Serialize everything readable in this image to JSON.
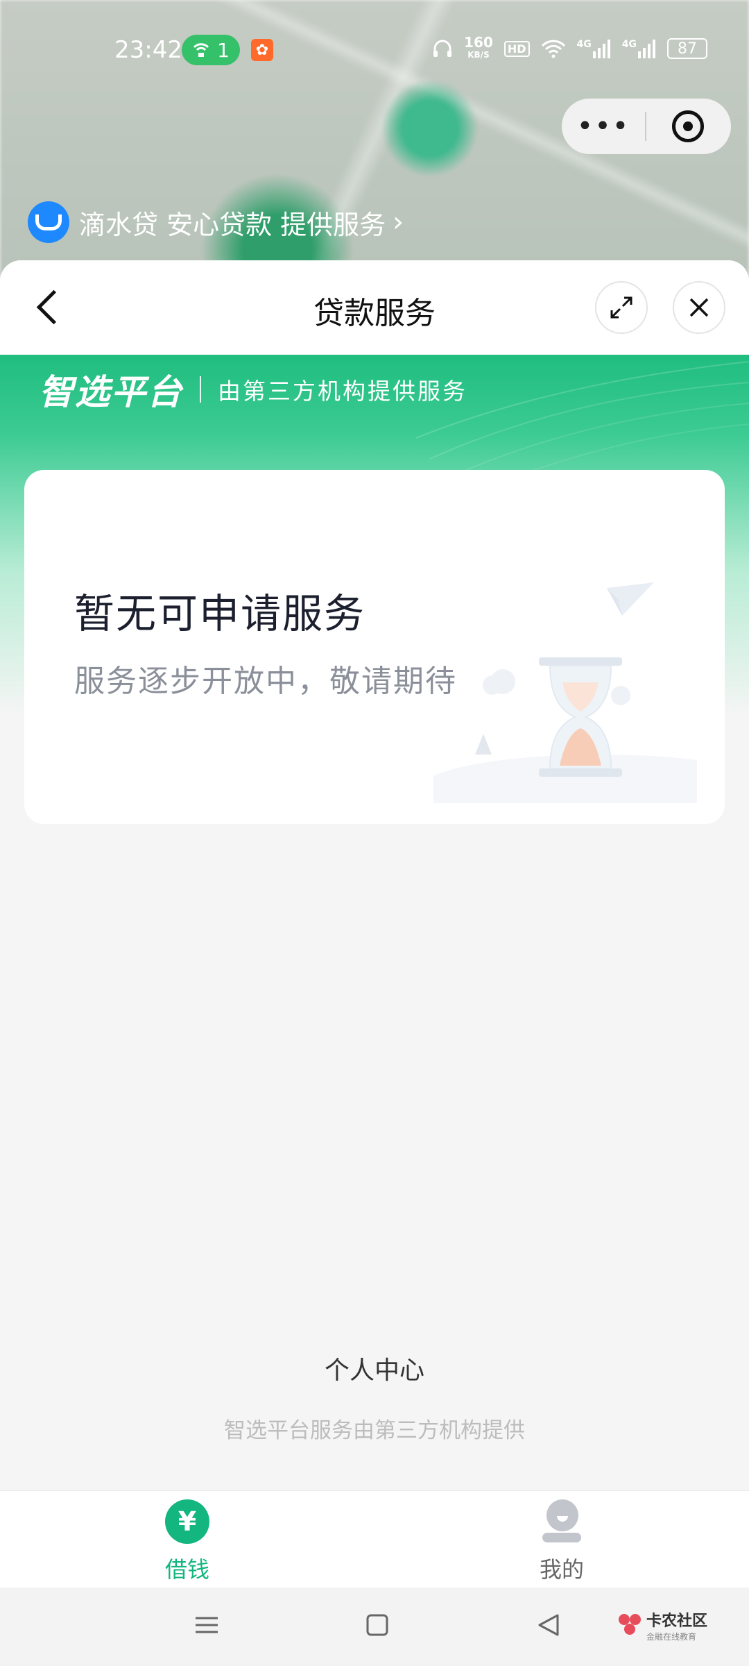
{
  "status_bar": {
    "time": "23:42",
    "hotspot_count": "1",
    "speed_value": "160",
    "speed_unit": "KB/S",
    "hd_label": "HD",
    "net1": "4G",
    "net2": "4G",
    "battery": "87"
  },
  "provider_banner": {
    "text": "滴水贷 安心贷款 提供服务",
    "chevron": "›"
  },
  "nav": {
    "title": "贷款服务"
  },
  "header": {
    "brand": "智选平台",
    "subtitle": "由第三方机构提供服务",
    "accent": "#20bd7f"
  },
  "empty_state": {
    "title": "暂无可申请服务",
    "subtitle": "服务逐步开放中，敬请期待"
  },
  "footer": {
    "personal_center": "个人中心",
    "note": "智选平台服务由第三方机构提供"
  },
  "tabbar": {
    "tabs": [
      {
        "label": "借钱",
        "icon": "yen-icon",
        "active": true,
        "color": "#13b67e"
      },
      {
        "label": "我的",
        "icon": "user-icon",
        "active": false,
        "color": "#666666"
      }
    ],
    "yen_symbol": "¥"
  },
  "watermark": {
    "title": "卡农社区",
    "subtitle": "金融在线教育"
  }
}
